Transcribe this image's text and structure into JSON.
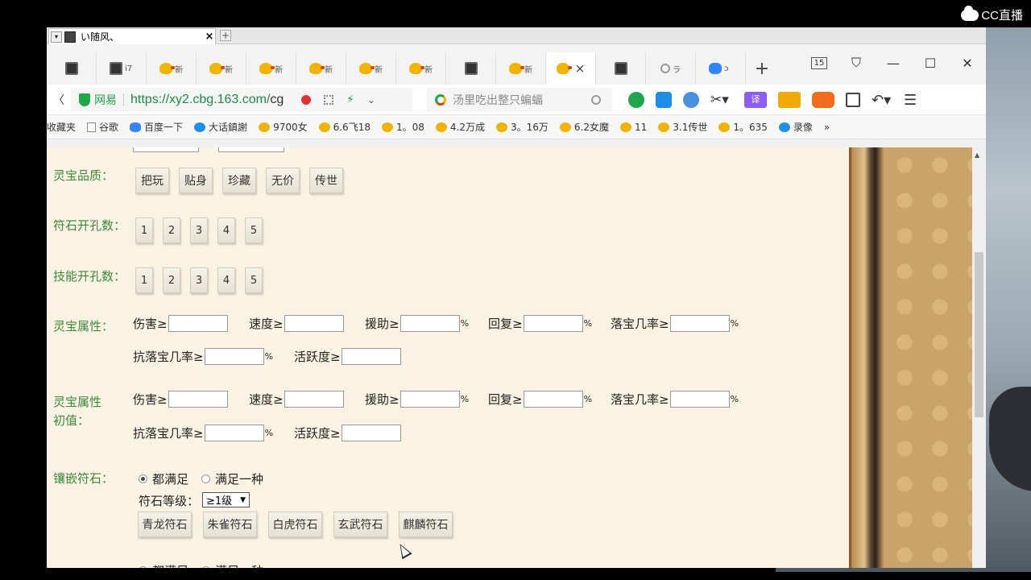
{
  "watermark": {
    "text": "CC直播"
  },
  "window": {
    "mini_tab_title": "い随风、",
    "mini_tab_close": "×",
    "mini_add": "+",
    "tab_new": "+",
    "active_tab_close": "×",
    "tab_badge": "15",
    "min_btn": "—",
    "max_btn": "☐",
    "close_btn": "✕"
  },
  "tabs": [
    {
      "icon": "photo-icon",
      "label": ""
    },
    {
      "icon": "photo-icon",
      "label": "i7"
    },
    {
      "icon": "duck-icon",
      "label": "新"
    },
    {
      "icon": "duck-icon",
      "label": "新"
    },
    {
      "icon": "duck-icon",
      "label": "新"
    },
    {
      "icon": "duck-icon",
      "label": "新"
    },
    {
      "icon": "duck-icon",
      "label": "新"
    },
    {
      "icon": "duck-icon",
      "label": "新"
    },
    {
      "icon": "photo-icon",
      "label": ""
    },
    {
      "icon": "duck-icon",
      "label": "新"
    },
    {
      "icon": "duck-icon",
      "label": "",
      "active": true
    },
    {
      "icon": "photo-icon",
      "label": ""
    },
    {
      "icon": "search-icon",
      "label": "ラ"
    },
    {
      "icon": "baidu-icon",
      "label": "ɔ"
    }
  ],
  "address": {
    "site_name": "网易",
    "url_main": "https://xy2.cbg.163.com/",
    "url_rest": "cg",
    "search_placeholder": "汤里吃出整只蝙蝠"
  },
  "toolbar": {
    "translate_label": "译"
  },
  "bookmarks": [
    {
      "icon": "none",
      "label": "收藏夹"
    },
    {
      "icon": "doc",
      "label": "谷歌"
    },
    {
      "icon": "paw",
      "label": "百度一下"
    },
    {
      "icon": "dahua",
      "label": "大话鎮謝"
    },
    {
      "icon": "duck",
      "label": "9700女"
    },
    {
      "icon": "duck",
      "label": "6.6飞18"
    },
    {
      "icon": "duck",
      "label": "1。08"
    },
    {
      "icon": "duck",
      "label": "4.2万成"
    },
    {
      "icon": "duck",
      "label": "3。16万"
    },
    {
      "icon": "duck",
      "label": "6.2女魔"
    },
    {
      "icon": "duck",
      "label": "11"
    },
    {
      "icon": "duck",
      "label": "3.1传世"
    },
    {
      "icon": "duck",
      "label": "1。635"
    },
    {
      "icon": "dahua",
      "label": "录像"
    },
    {
      "icon": "none",
      "label": "»"
    }
  ],
  "form": {
    "quality_label": "灵宝品质：",
    "quality_options": [
      "把玩",
      "贴身",
      "珍藏",
      "无价",
      "传世"
    ],
    "rune_holes_label": "符石开孔数：",
    "rune_holes": [
      "1",
      "2",
      "3",
      "4",
      "5"
    ],
    "skill_holes_label": "技能开孔数：",
    "skill_holes": [
      "1",
      "2",
      "3",
      "4",
      "5"
    ],
    "attr_label": "灵宝属性：",
    "attr_init_label_1": "灵宝属性",
    "attr_init_label_2": "初值：",
    "attrs": {
      "damage": "伤害≥",
      "speed": "速度≥",
      "assist": "援助≥",
      "recover": "回复≥",
      "drop_rate": "落宝几率≥",
      "anti_drop": "抗落宝几率≥",
      "activity": "活跃度≥",
      "percent": "%"
    },
    "inlay_label": "镶嵌符石：",
    "inlay_all": "都满足",
    "inlay_one": "满足一种",
    "rune_level_label": "符石等级：",
    "rune_level_value": "≥1级",
    "runes": [
      "青龙符石",
      "朱雀符石",
      "白虎符石",
      "玄武符石",
      "麒麟符石"
    ]
  },
  "colors": {
    "label_green": "#3a8a3a",
    "page_bg": "#faf3e3",
    "url_green": "#1a8f3e"
  }
}
